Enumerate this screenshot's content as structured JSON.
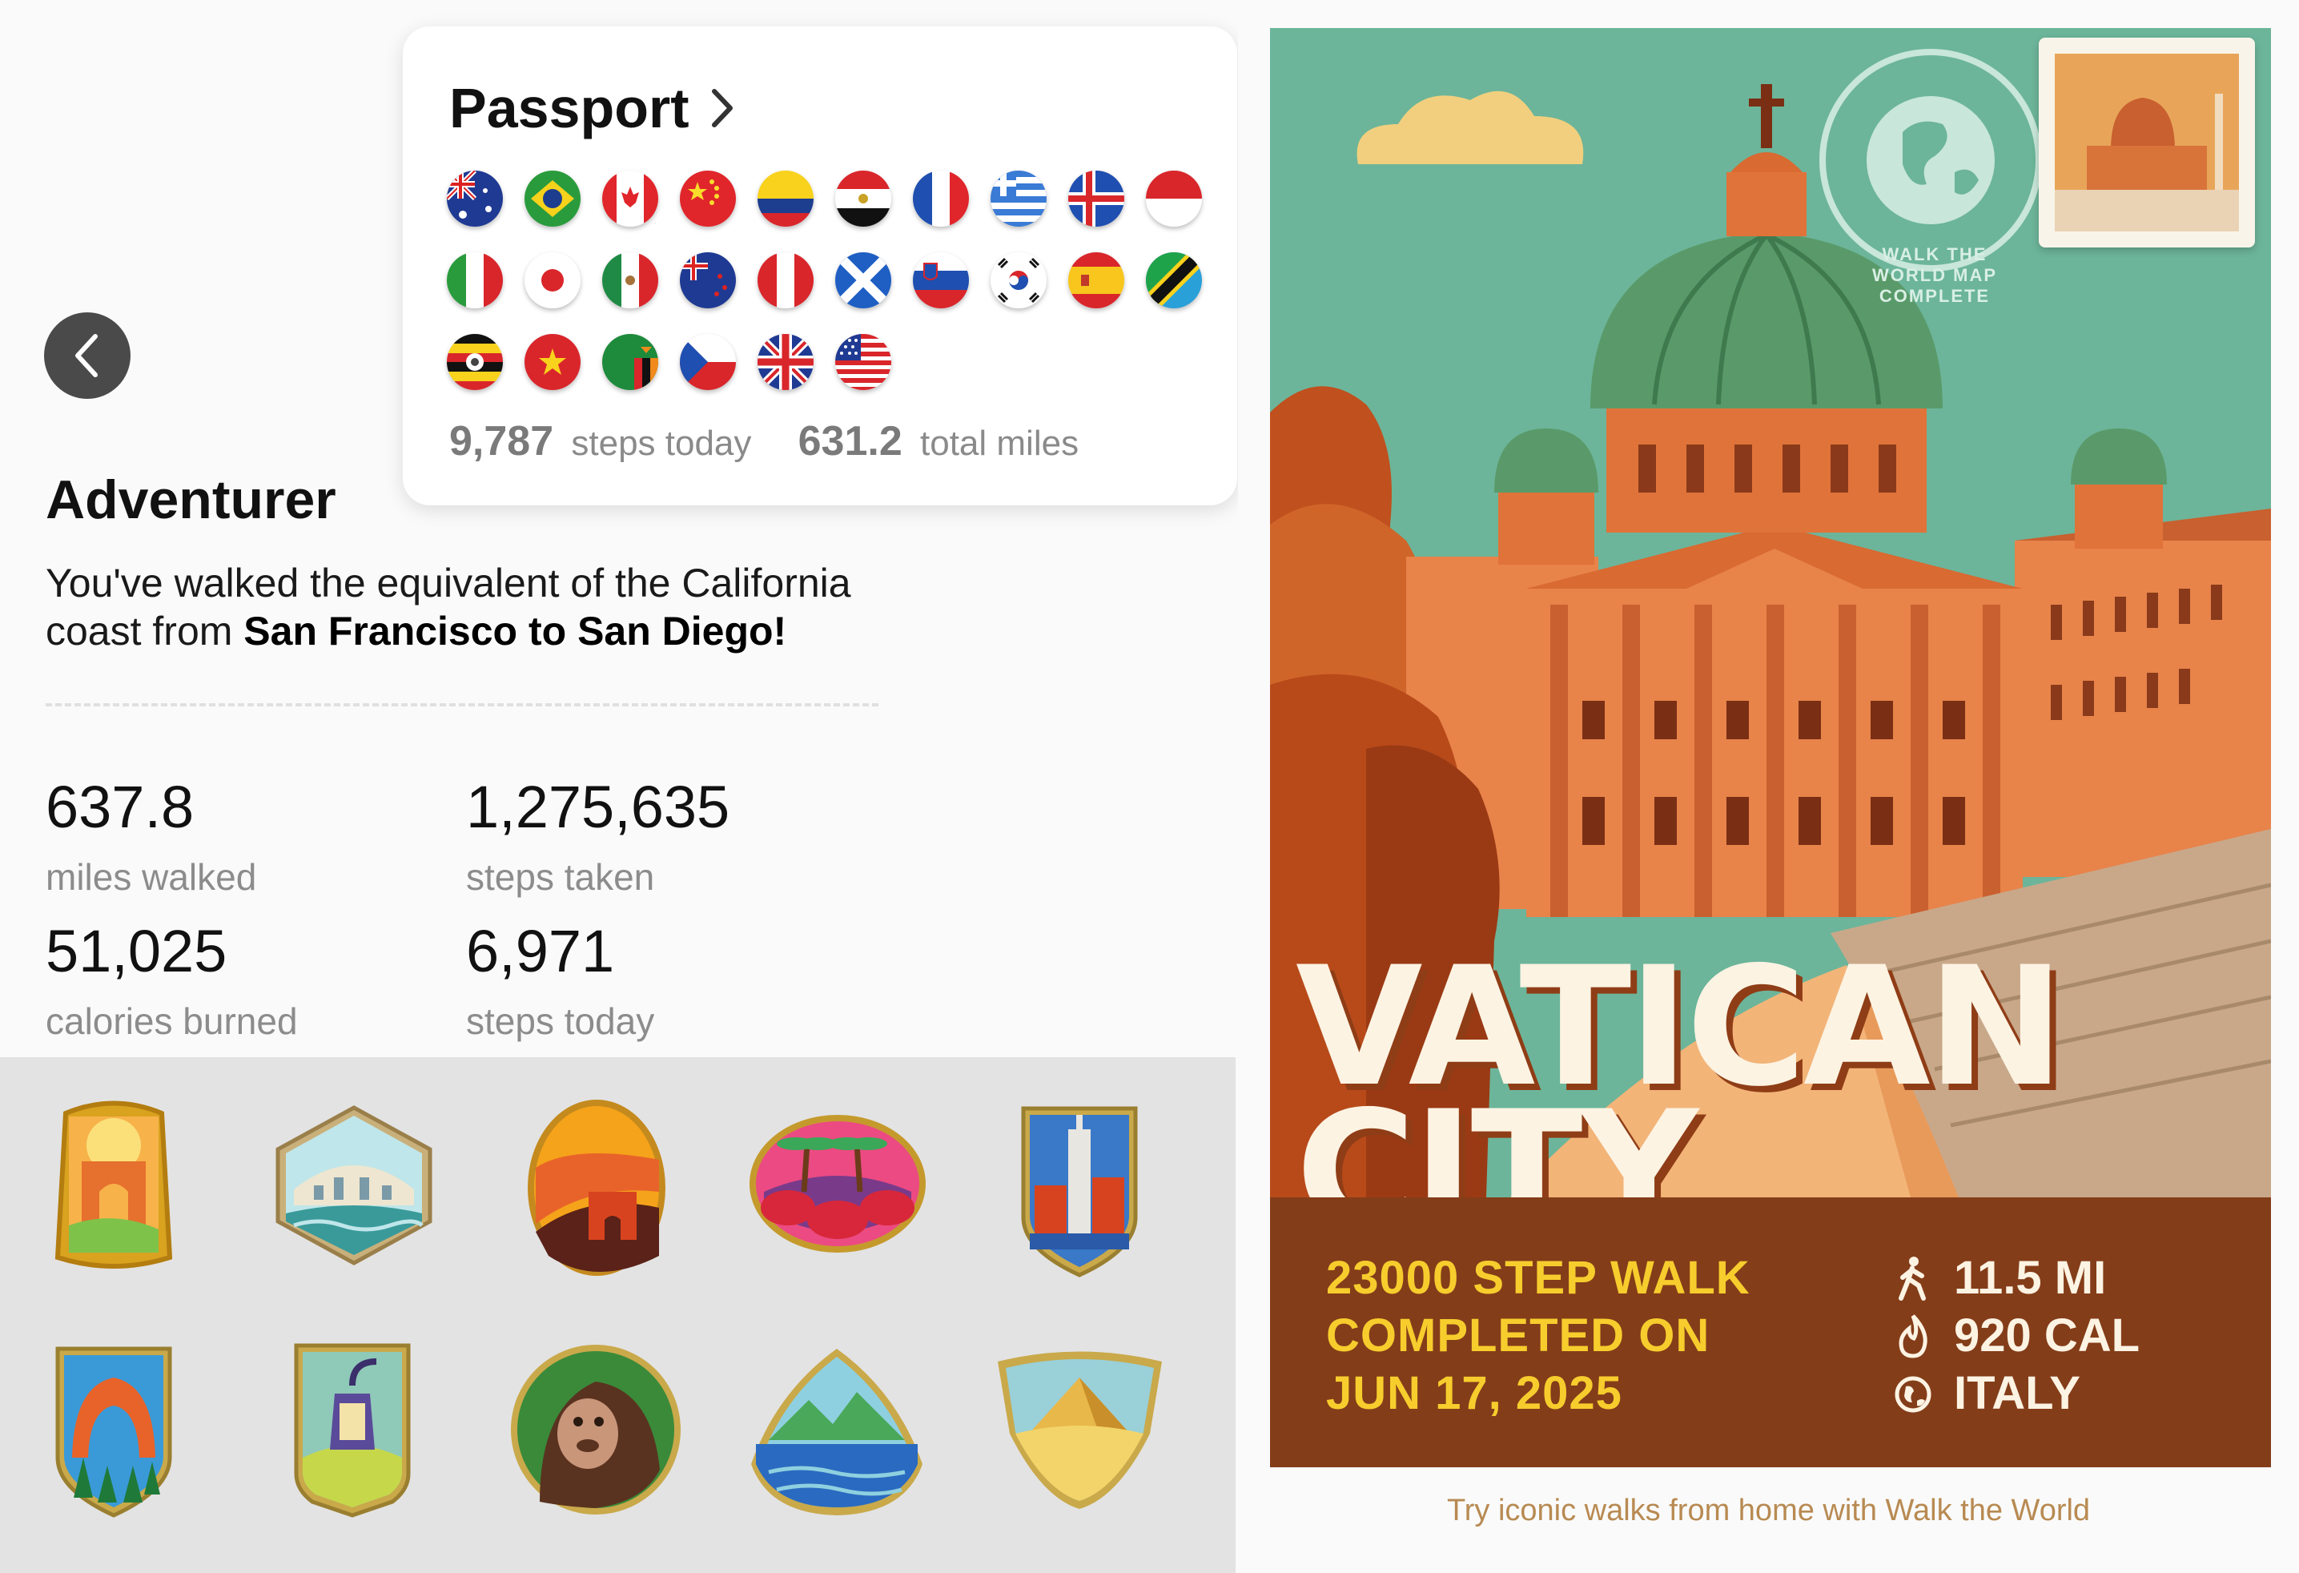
{
  "passport": {
    "title": "Passport",
    "flags": [
      "australia-flag",
      "brazil-flag",
      "canada-flag",
      "china-flag",
      "colombia-flag",
      "egypt-flag",
      "france-flag",
      "greece-flag",
      "iceland-flag",
      "indonesia-flag",
      "italy-flag",
      "japan-flag",
      "mexico-flag",
      "new-zealand-flag",
      "peru-flag",
      "scotland-flag",
      "slovenia-flag",
      "south-korea-flag",
      "spain-flag",
      "tanzania-flag",
      "uganda-flag",
      "vietnam-flag",
      "zambia-flag",
      "czech-republic-flag",
      "united-kingdom-flag",
      "united-states-flag"
    ],
    "steps_today_value": "9,787",
    "steps_today_label": "steps today",
    "total_miles_value": "631.2",
    "total_miles_label": "total miles"
  },
  "achievement": {
    "title": "Adventurer",
    "description_start": "You've walked the equivalent of the California coast from ",
    "description_bold": "San Francisco to San Diego!"
  },
  "stats": {
    "miles_value": "637.8",
    "miles_label": "miles walked",
    "steps_value": "1,275,635",
    "steps_label": "steps taken",
    "calories_value": "51,025",
    "calories_label": "calories burned",
    "today_value": "6,971",
    "today_label": "steps today"
  },
  "badges": [
    "arch-badge",
    "bridge-badge",
    "great-wall-badge",
    "palm-tree-badge",
    "skyscraper-badge",
    "rock-arch-badge",
    "lantern-badge",
    "gorilla-badge",
    "mountain-lake-badge",
    "pyramid-badge"
  ],
  "poster": {
    "stamp_text": "WALK THE WORLD MAP COMPLETE",
    "title_line1": "VATICAN",
    "title_line2": "CITY",
    "walk_line1": "23000 STEP WALK",
    "walk_line2": "COMPLETED ON",
    "walk_line3": "JUN 17, 2025",
    "distance": "11.5 MI",
    "calories": "920 CAL",
    "country": "ITALY",
    "caption": "Try iconic walks from home with Walk the World"
  },
  "colors": {
    "poster_bg": "#6cb59a",
    "info_band": "#843d19",
    "walk_text": "#f7cd2d",
    "title_text": "#fcf3e3"
  }
}
